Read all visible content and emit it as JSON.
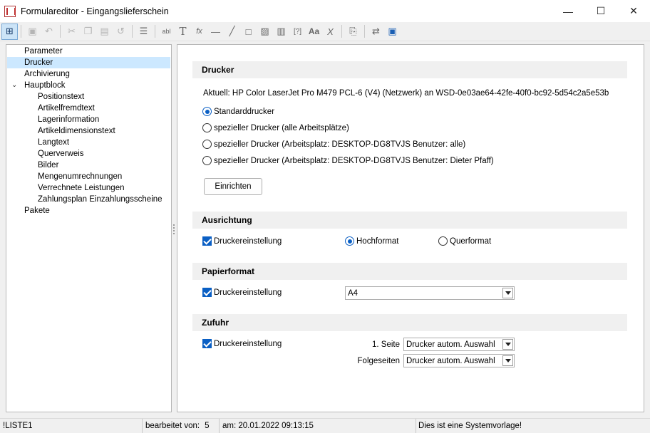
{
  "window": {
    "title": "Formulareditor - Eingangslieferschein"
  },
  "window_controls": {
    "minimize": "—",
    "maximize": "☐",
    "close": "✕"
  },
  "tree": {
    "items": [
      {
        "label": "Parameter",
        "level": 0
      },
      {
        "label": "Drucker",
        "level": 0,
        "selected": true
      },
      {
        "label": "Archivierung",
        "level": 0
      },
      {
        "label": "Hauptblock",
        "level": 0,
        "expanded": true
      },
      {
        "label": "Positionstext",
        "level": 1
      },
      {
        "label": "Artikelfremdtext",
        "level": 1
      },
      {
        "label": "Lagerinformation",
        "level": 1
      },
      {
        "label": "Artikeldimensionstext",
        "level": 1
      },
      {
        "label": "Langtext",
        "level": 1
      },
      {
        "label": "Querverweis",
        "level": 1
      },
      {
        "label": "Bilder",
        "level": 1
      },
      {
        "label": "Mengenumrechnungen",
        "level": 1
      },
      {
        "label": "Verrechnete Leistungen",
        "level": 1
      },
      {
        "label": "Zahlungsplan Einzahlungsscheine",
        "level": 1
      },
      {
        "label": "Pakete",
        "level": 0
      }
    ]
  },
  "drucker": {
    "header": "Drucker",
    "current": "Aktuell: HP Color LaserJet Pro M479 PCL-6 (V4) (Netzwerk) an WSD-0e03ae64-42fe-40f0-bc92-5d54c2a5e53b",
    "options": [
      {
        "label": "Standarddrucker",
        "checked": true
      },
      {
        "label": "spezieller Drucker (alle Arbeitsplätze)",
        "checked": false
      },
      {
        "label": "spezieller Drucker (Arbeitsplatz: DESKTOP-DG8TVJS Benutzer: alle)",
        "checked": false
      },
      {
        "label": "spezieller Drucker (Arbeitsplatz: DESKTOP-DG8TVJS Benutzer: Dieter Pfaff)",
        "checked": false
      }
    ],
    "setup_button": "Einrichten"
  },
  "ausrichtung": {
    "header": "Ausrichtung",
    "checkbox_label": "Druckereinstellung",
    "portrait": "Hochformat",
    "landscape": "Querformat"
  },
  "papierformat": {
    "header": "Papierformat",
    "checkbox_label": "Druckereinstellung",
    "value": "A4"
  },
  "zufuhr": {
    "header": "Zufuhr",
    "checkbox_label": "Druckereinstellung",
    "first_page_label": "1. Seite",
    "first_page_value": "Drucker autom. Auswahl",
    "next_pages_label": "Folgeseiten",
    "next_pages_value": "Drucker autom. Auswahl"
  },
  "status": {
    "list": "!LISTE1",
    "edited_by_label": "bearbeitet von:",
    "edited_by_value": "5",
    "at": "am: 20.01.2022 09:13:15",
    "note": "Dies ist eine Systemvorlage!"
  },
  "toolbar_icons": [
    "tree-icon",
    "save-icon",
    "undo-arrow-icon",
    "cut-icon",
    "copy-icon",
    "paste-icon",
    "undo-icon",
    "list-icon",
    "textfield-icon",
    "text-icon",
    "formula-icon",
    "line-icon",
    "diagonal-line-icon",
    "rectangle-icon",
    "image-icon",
    "barcode-icon",
    "variable-icon",
    "font-icon",
    "clear-format-icon",
    "pages-icon",
    "tab-order-icon",
    "preview-icon"
  ]
}
